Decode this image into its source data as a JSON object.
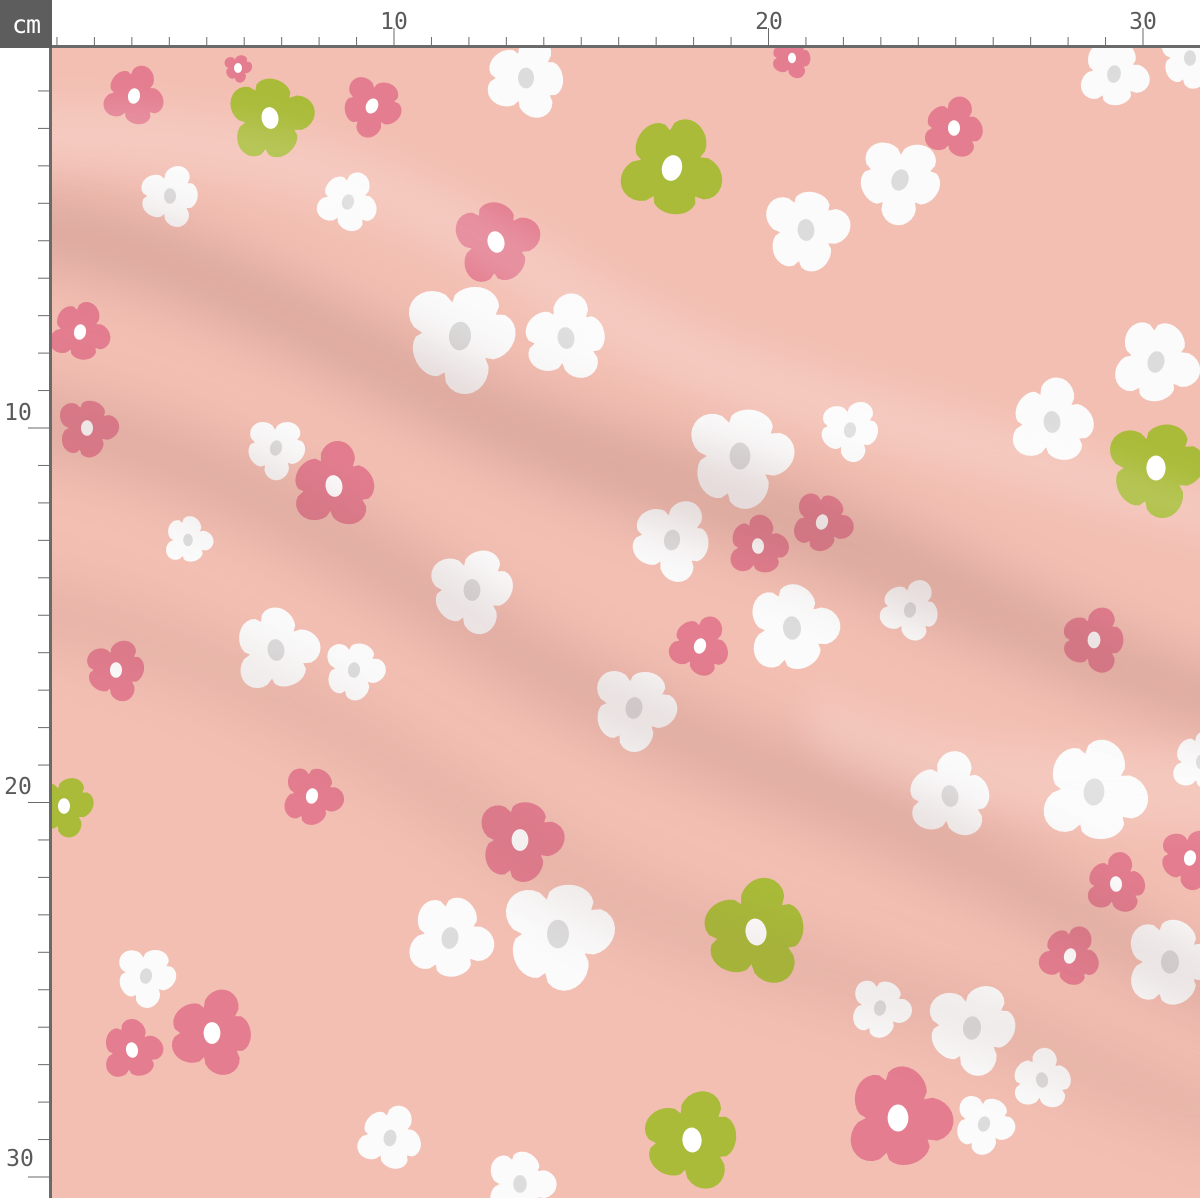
{
  "unit_label": "cm",
  "ruler": {
    "top_labels": [
      "10",
      "20",
      "30"
    ],
    "left_labels": [
      "10",
      "20",
      "30"
    ]
  },
  "colors": {
    "fabric": "#f3bfb3",
    "flower_white": "#fbfbfb",
    "flower_white_center": "#dcdcdc",
    "flower_pink": "#e37d8f",
    "flower_green": "#a9bb38",
    "ruler_badge": "#5d5d5d"
  },
  "pattern": {
    "motif": "flower-icon",
    "kinds": [
      "white",
      "pink",
      "green"
    ]
  }
}
